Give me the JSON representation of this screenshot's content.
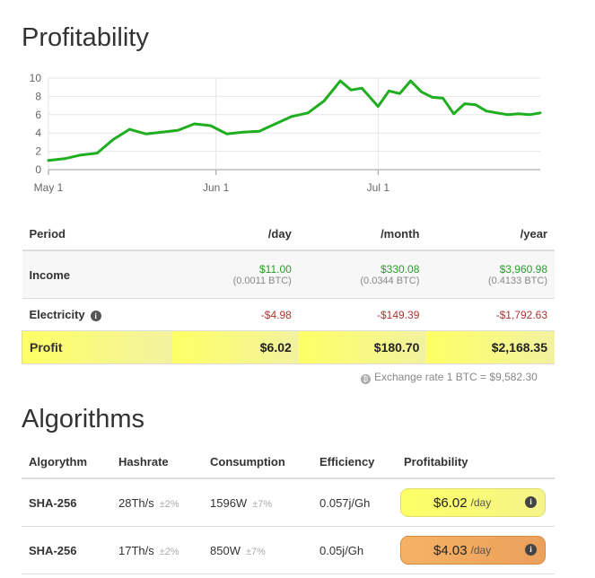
{
  "profitability": {
    "title": "Profitability",
    "chart_data": {
      "type": "line",
      "y_ticks": [
        "10",
        "8",
        "6",
        "4",
        "2",
        "0"
      ],
      "x_ticks": [
        "May 1",
        "Jun 1",
        "Jul 1"
      ],
      "ylim": [
        0,
        10
      ],
      "grid": true,
      "series_color": "#1fae1f",
      "x": [
        "May 1",
        "May 4",
        "May 7",
        "May 10",
        "May 13",
        "May 16",
        "May 19",
        "May 22",
        "May 25",
        "May 28",
        "May 31",
        "Jun 3",
        "Jun 6",
        "Jun 9",
        "Jun 12",
        "Jun 15",
        "Jun 18",
        "Jun 21",
        "Jun 24",
        "Jun 26",
        "Jun 28",
        "Jul 1",
        "Jul 3",
        "Jul 5",
        "Jul 7",
        "Jul 9",
        "Jul 11",
        "Jul 13",
        "Jul 15",
        "Jul 17",
        "Jul 19",
        "Jul 21",
        "Jul 23",
        "Jul 25",
        "Jul 27",
        "Jul 29",
        "Jul 31"
      ],
      "values": [
        1.0,
        1.2,
        1.6,
        1.8,
        3.3,
        4.4,
        3.9,
        4.1,
        4.3,
        5.0,
        4.8,
        3.9,
        4.1,
        4.2,
        5.0,
        5.8,
        6.2,
        7.5,
        9.7,
        8.7,
        8.9,
        6.9,
        8.6,
        8.3,
        9.7,
        8.5,
        7.9,
        7.8,
        6.1,
        7.2,
        7.1,
        6.4,
        6.2,
        6.0,
        6.1,
        6.0,
        6.2
      ]
    },
    "table": {
      "headers": [
        "Period",
        "/day",
        "/month",
        "/year"
      ],
      "income": {
        "label": "Income",
        "day": "$11.00",
        "day_btc": "(0.0011 BTC)",
        "month": "$330.08",
        "month_btc": "(0.0344 BTC)",
        "year": "$3,960.98",
        "year_btc": "(0.4133 BTC)"
      },
      "electricity": {
        "label": "Electricity",
        "day": "-$4.98",
        "month": "-$149.39",
        "year": "-$1,792.63"
      },
      "profit": {
        "label": "Profit",
        "day": "$6.02",
        "month": "$180.70",
        "year": "$2,168.35"
      }
    },
    "exchange_rate": "Exchange rate 1 BTC = $9,582.30"
  },
  "algorithms": {
    "title": "Algorithms",
    "headers": [
      "Algorythm",
      "Hashrate",
      "Consumption",
      "Efficiency",
      "Profitability"
    ],
    "rows": [
      {
        "algorithm": "SHA-256",
        "hashrate": "28Th/s",
        "hashrate_tol": "±2%",
        "consumption": "1596W",
        "consumption_tol": "±7%",
        "efficiency": "0.057j/Gh",
        "profit": "$6.02",
        "per": "/day"
      },
      {
        "algorithm": "SHA-256",
        "hashrate": "17Th/s",
        "hashrate_tol": "±2%",
        "consumption": "850W",
        "consumption_tol": "±7%",
        "efficiency": "0.05j/Gh",
        "profit": "$4.03",
        "per": "/day"
      }
    ]
  }
}
